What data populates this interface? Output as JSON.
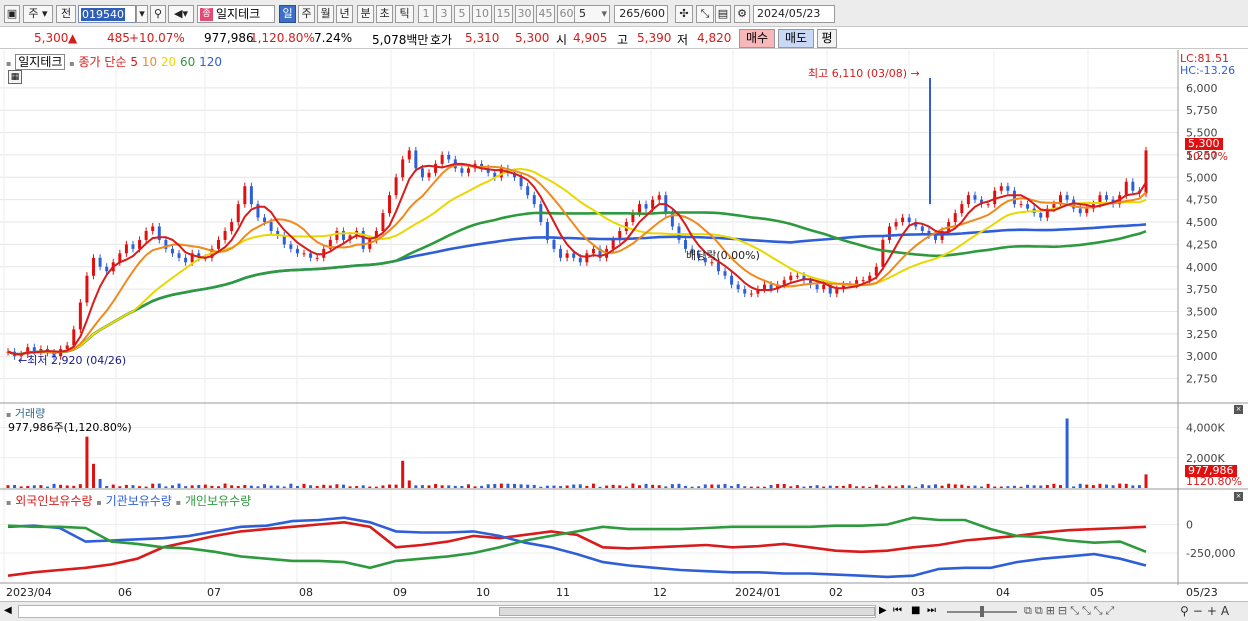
{
  "toolbar": {
    "period_mode": "주",
    "prev_label": "전",
    "code": "019540",
    "stock_name": "일지테크",
    "name_badge": "종",
    "periods": [
      "일",
      "주",
      "월",
      "년",
      "분",
      "초",
      "틱"
    ],
    "intervals": [
      "1",
      "3",
      "5",
      "10",
      "15",
      "30",
      "45",
      "60"
    ],
    "interval_select": "5",
    "bar_count": "265",
    "bar_total": "/600",
    "date": "2024/05/23"
  },
  "quote": {
    "price": "5,300",
    "change_arrow": "▲",
    "change": "485",
    "change_pct": "+10.07%",
    "volume": "977,986",
    "vol_ratio": "1,120.80%",
    "turnover": "7.24%",
    "amount": "5,078백만",
    "hoga_label": "호가",
    "ask": "5,310",
    "bid": "5,300",
    "open_label": "시",
    "open": "4,905",
    "high_label": "고",
    "high": "5,390",
    "low_label": "저",
    "low": "4,820",
    "buy_label": "매수",
    "sell_label": "매도",
    "avg_label": "평"
  },
  "legend": {
    "name": "일지테크",
    "close_label": "종가",
    "ma_type": "단순",
    "ma": [
      "5",
      "10",
      "20",
      "60",
      "120"
    ],
    "ma_colors": [
      "#d81b1b",
      "#f08a1c",
      "#e8d800",
      "#2e9a3e",
      "#2f5fd8"
    ]
  },
  "annotations": {
    "high": "최고 6,110 (03/08)",
    "low": "최저 2,920 (04/26)",
    "dividend": "배당락(0.00%)"
  },
  "lc_hc": {
    "lc": "LC:81.51",
    "hc": "HC:-13.26"
  },
  "price_badge": {
    "price": "5,300",
    "pct": "10.07%"
  },
  "volume_panel": {
    "title": "거래량",
    "detail": "977,986주(1,120.80%)",
    "badge_vol": "977,986",
    "badge_pct": "1120.80%"
  },
  "holding_panel": {
    "legends": [
      "외국인보유수량",
      "기관보유수량",
      "개인보유수량"
    ],
    "colors": [
      "#d81b1b",
      "#2f5fd8",
      "#2e9a3e"
    ]
  },
  "x_labels": [
    "2023/04",
    "06",
    "07",
    "08",
    "09",
    "10",
    "11",
    "12",
    "2024/01",
    "02",
    "03",
    "04",
    "05",
    "05/23"
  ],
  "chart_data": [
    {
      "type": "line",
      "title": "일지테크 종가 단순",
      "y_ticks": [
        "6,000",
        "5,750",
        "5,500",
        "5,250",
        "5,000",
        "4,750",
        "4,500",
        "4,250",
        "4,000",
        "3,750",
        "3,500",
        "3,250",
        "3,000",
        "2,750"
      ],
      "ylim": [
        2600,
        6110
      ],
      "series": [
        {
          "name": "종가",
          "values": [
            3050,
            3000,
            3020,
            3100,
            3050,
            3080,
            3040,
            3000,
            3080,
            3120,
            3300,
            3600,
            3900,
            4100,
            4000,
            3950,
            4050,
            4150,
            4250,
            4200,
            4300,
            4400,
            4450,
            4300,
            4200,
            4150,
            4100,
            4050,
            4150,
            4100,
            4100,
            4200,
            4300,
            4400,
            4500,
            4700,
            4900,
            4700,
            4550,
            4500,
            4400,
            4350,
            4250,
            4200,
            4150,
            4150,
            4100,
            4100,
            4200,
            4300,
            4400,
            4300,
            4350,
            4400,
            4200,
            4300,
            4400,
            4600,
            4800,
            5000,
            5200,
            5300,
            5100,
            5000,
            5050,
            5150,
            5250,
            5200,
            5100,
            5050,
            5100,
            5150,
            5100,
            5050,
            5000,
            5100,
            5050,
            5000,
            4900,
            4800,
            4700,
            4500,
            4300,
            4200,
            4100,
            4150,
            4100,
            4050,
            4150,
            4200,
            4100,
            4200,
            4300,
            4400,
            4500,
            4600,
            4700,
            4650,
            4750,
            4800,
            4600,
            4450,
            4300,
            4200,
            4150,
            4100,
            4050,
            4050,
            3950,
            3900,
            3800,
            3750,
            3700,
            3700,
            3750,
            3800,
            3750,
            3800,
            3850,
            3900,
            3900,
            3850,
            3800,
            3750,
            3800,
            3700,
            3750,
            3800,
            3800,
            3850,
            3850,
            3900,
            4000,
            4300,
            4450,
            4500,
            4550,
            4500,
            4450,
            4400,
            4350,
            4300,
            4400,
            4500,
            4600,
            4700,
            4800,
            4750,
            4700,
            4700,
            4850,
            4900,
            4850,
            4700,
            4700,
            4650,
            4600,
            4550,
            4650,
            4700,
            4800,
            4750,
            4650,
            4600,
            4650,
            4700,
            4800,
            4750,
            4700,
            4800,
            4950,
            4850,
            4820,
            5300
          ]
        },
        {
          "name": "5",
          "values": []
        },
        {
          "name": "10",
          "values": []
        },
        {
          "name": "20",
          "values": []
        },
        {
          "name": "60",
          "values": []
        },
        {
          "name": "120",
          "values": []
        }
      ]
    },
    {
      "type": "bar",
      "title": "거래량",
      "y_ticks": [
        "4,000K",
        "2,000K",
        "0"
      ],
      "ylim": [
        0,
        4500
      ]
    },
    {
      "type": "line",
      "title": "보유수량",
      "y_ticks": [
        "0",
        "-250,000"
      ],
      "series": [
        {
          "name": "외국인보유수량",
          "values": [
            -450,
            -420,
            -400,
            -380,
            -350,
            -300,
            -200,
            -150,
            -100,
            -60,
            -40,
            -20,
            0,
            20,
            -20,
            -200,
            -180,
            -150,
            -100,
            -120,
            -90,
            -60,
            -90,
            -200,
            -210,
            -200,
            -190,
            -180,
            -200,
            -190,
            -170,
            -200,
            -230,
            -240,
            -230,
            -200,
            -180,
            -140,
            -120,
            -100,
            -70,
            -50,
            -40,
            -30,
            -20
          ]
        },
        {
          "name": "기관보유수량",
          "values": [
            -20,
            -10,
            -30,
            -150,
            -140,
            -130,
            -120,
            -100,
            -60,
            -20,
            -10,
            30,
            40,
            60,
            20,
            -60,
            -70,
            -70,
            -60,
            -100,
            -160,
            -200,
            -260,
            -330,
            -360,
            -380,
            -400,
            -410,
            -420,
            -420,
            -430,
            -430,
            -440,
            -450,
            -460,
            -450,
            -390,
            -380,
            -380,
            -330,
            -300,
            -280,
            -260,
            -300,
            -360
          ]
        },
        {
          "name": "개인보유수량",
          "values": [
            -10,
            -20,
            -20,
            -30,
            -150,
            -170,
            -200,
            -210,
            -240,
            -280,
            -300,
            -320,
            -320,
            -330,
            -380,
            -320,
            -300,
            -280,
            -250,
            -200,
            -140,
            -100,
            -60,
            -20,
            -40,
            -40,
            -40,
            -30,
            -20,
            -20,
            -20,
            -20,
            -10,
            -10,
            0,
            60,
            40,
            40,
            -40,
            -100,
            -110,
            -140,
            -160,
            -150,
            -240
          ]
        }
      ]
    }
  ]
}
